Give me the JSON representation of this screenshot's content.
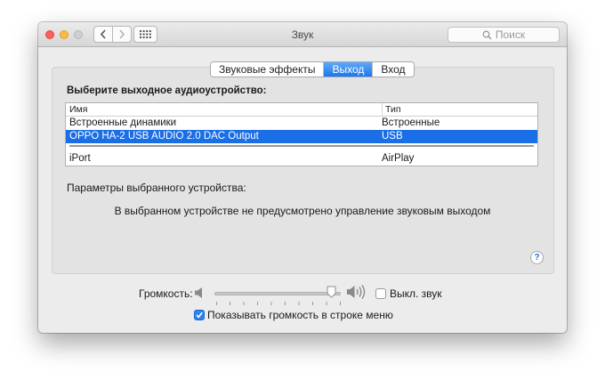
{
  "window": {
    "title": "Звук",
    "search_placeholder": "Поиск"
  },
  "icons": {
    "back": "chevron-left-icon",
    "forward": "chevron-right-icon",
    "grid": "grid-icon",
    "search": "search-icon",
    "volume_low": "speaker-low-icon",
    "volume_high": "speaker-high-icon",
    "help": "question-icon"
  },
  "tabs": [
    {
      "label": "Звуковые эффекты",
      "active": false
    },
    {
      "label": "Выход",
      "active": true
    },
    {
      "label": "Вход",
      "active": false
    }
  ],
  "output": {
    "heading": "Выберите выходное аудиоустройство:",
    "columns": {
      "name": "Имя",
      "type": "Тип"
    },
    "rows": [
      {
        "name": "Встроенные динамики",
        "type": "Встроенные",
        "selected": false
      },
      {
        "name": "OPPO HA-2 USB AUDIO 2.0 DAC Output",
        "type": "USB",
        "selected": true
      },
      {
        "name": "iPort",
        "type": "AirPlay",
        "selected": false
      }
    ],
    "params_label": "Параметры выбранного устройства:",
    "message": "В выбранном устройстве не предусмотрено управление звуковым выходом",
    "help": "?"
  },
  "volume": {
    "label": "Громкость:",
    "level": 0.96,
    "mute_label": "Выкл. звук",
    "mute_checked": false,
    "show_in_menu_label": "Показывать громкость в строке меню",
    "show_in_menu_checked": true
  },
  "colors": {
    "selection": "#1a6ee6",
    "tab_active": "#1c77ee",
    "close": "#fc605c",
    "minimize": "#fdbc40"
  }
}
